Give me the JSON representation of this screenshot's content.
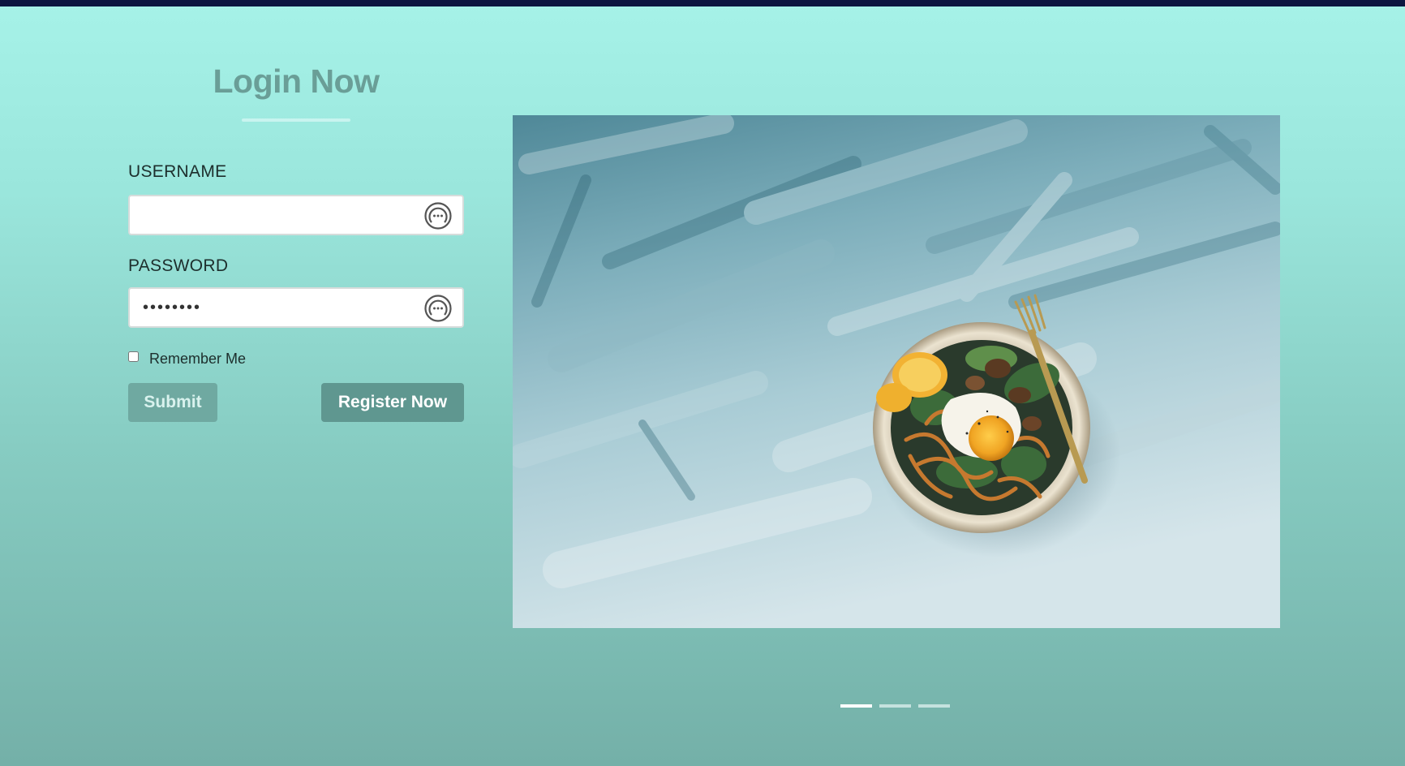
{
  "page": {
    "title": "Login Now"
  },
  "form": {
    "username_label": "USERNAME",
    "username_value": "",
    "password_label": "PASSWORD",
    "password_value": "••••••••",
    "remember_label": "Remember Me",
    "remember_checked": false,
    "submit_label": "Submit",
    "register_label": "Register Now"
  },
  "icons": {
    "field_icon": "chat-bubble-ellipsis-icon"
  },
  "carousel": {
    "image_subject": "bowl of noodles with fried egg on blue painted background",
    "slides": [
      {
        "active": true
      },
      {
        "active": false
      },
      {
        "active": false
      }
    ]
  },
  "colors": {
    "top_bar": "#0c1640",
    "title": "#6a9e97",
    "submit_bg": "#6fa9a1",
    "register_bg": "#5f9790"
  }
}
